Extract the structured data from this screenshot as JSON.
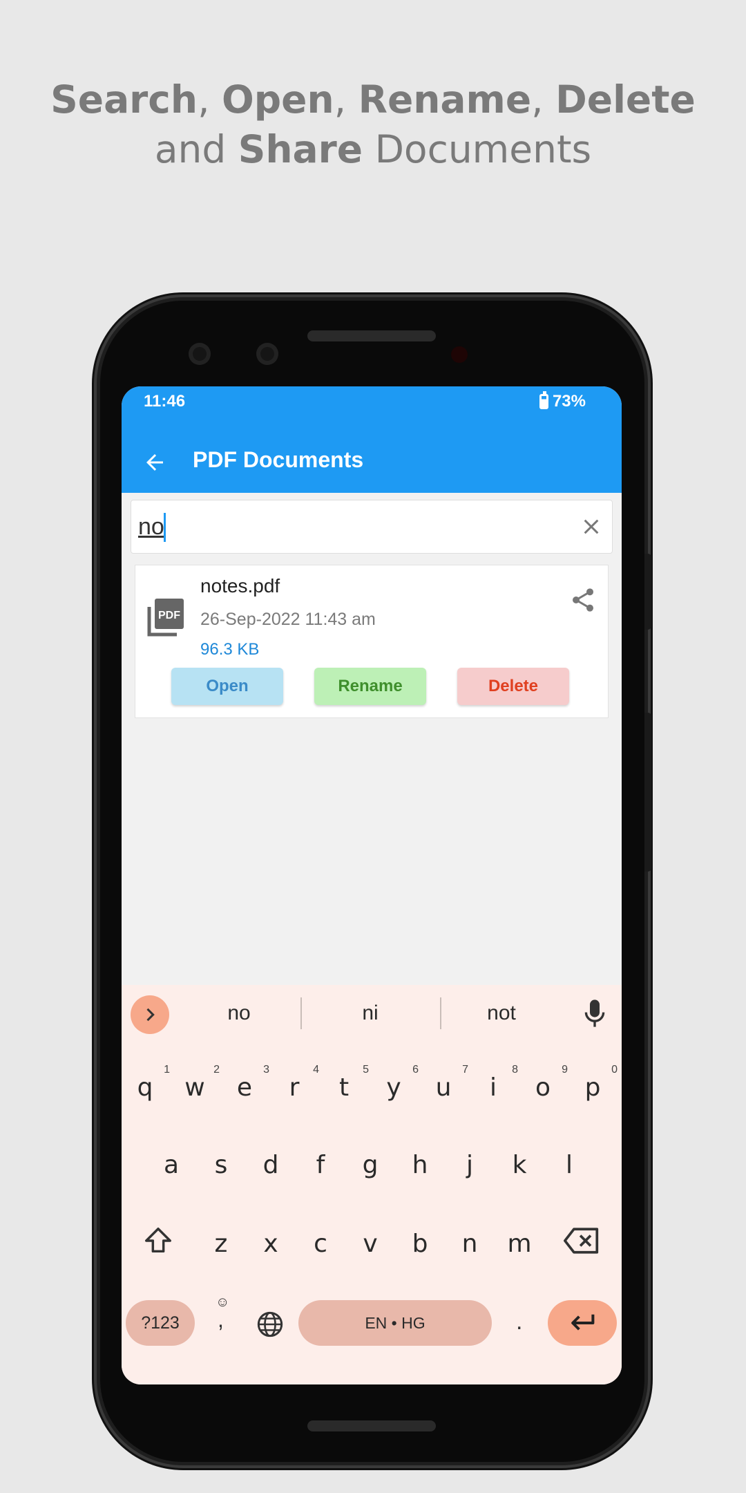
{
  "promo": {
    "w1": "Search",
    "c1": ",",
    "w2": "Open",
    "c2": ",",
    "w3": "Rename",
    "c3": ",",
    "w4": "Delete",
    "line2_pre": "and",
    "w5": "Share",
    "line2_post": "Documents"
  },
  "status": {
    "time": "11:46",
    "battery": "73%"
  },
  "appbar": {
    "title": "PDF Documents"
  },
  "search": {
    "value": "no"
  },
  "file": {
    "name": "notes.pdf",
    "date": "26-Sep-2022 11:43 am",
    "size": "96.3 KB",
    "open_label": "Open",
    "rename_label": "Rename",
    "delete_label": "Delete"
  },
  "keyboard": {
    "suggestions": [
      "no",
      "ni",
      "not"
    ],
    "row1": [
      "q",
      "w",
      "e",
      "r",
      "t",
      "y",
      "u",
      "i",
      "o",
      "p"
    ],
    "row1_nums": [
      "1",
      "2",
      "3",
      "4",
      "5",
      "6",
      "7",
      "8",
      "9",
      "0"
    ],
    "row2": [
      "a",
      "s",
      "d",
      "f",
      "g",
      "h",
      "j",
      "k",
      "l"
    ],
    "row3": [
      "z",
      "x",
      "c",
      "v",
      "b",
      "n",
      "m"
    ],
    "sym_label": "?123",
    "comma": ",",
    "emoji": "☺",
    "space_label": "EN • HG",
    "period": "."
  },
  "colors": {
    "appbar": "#1e9af3",
    "keyboard_bg": "#fdeeea",
    "accent_key": "#f7a88a"
  }
}
